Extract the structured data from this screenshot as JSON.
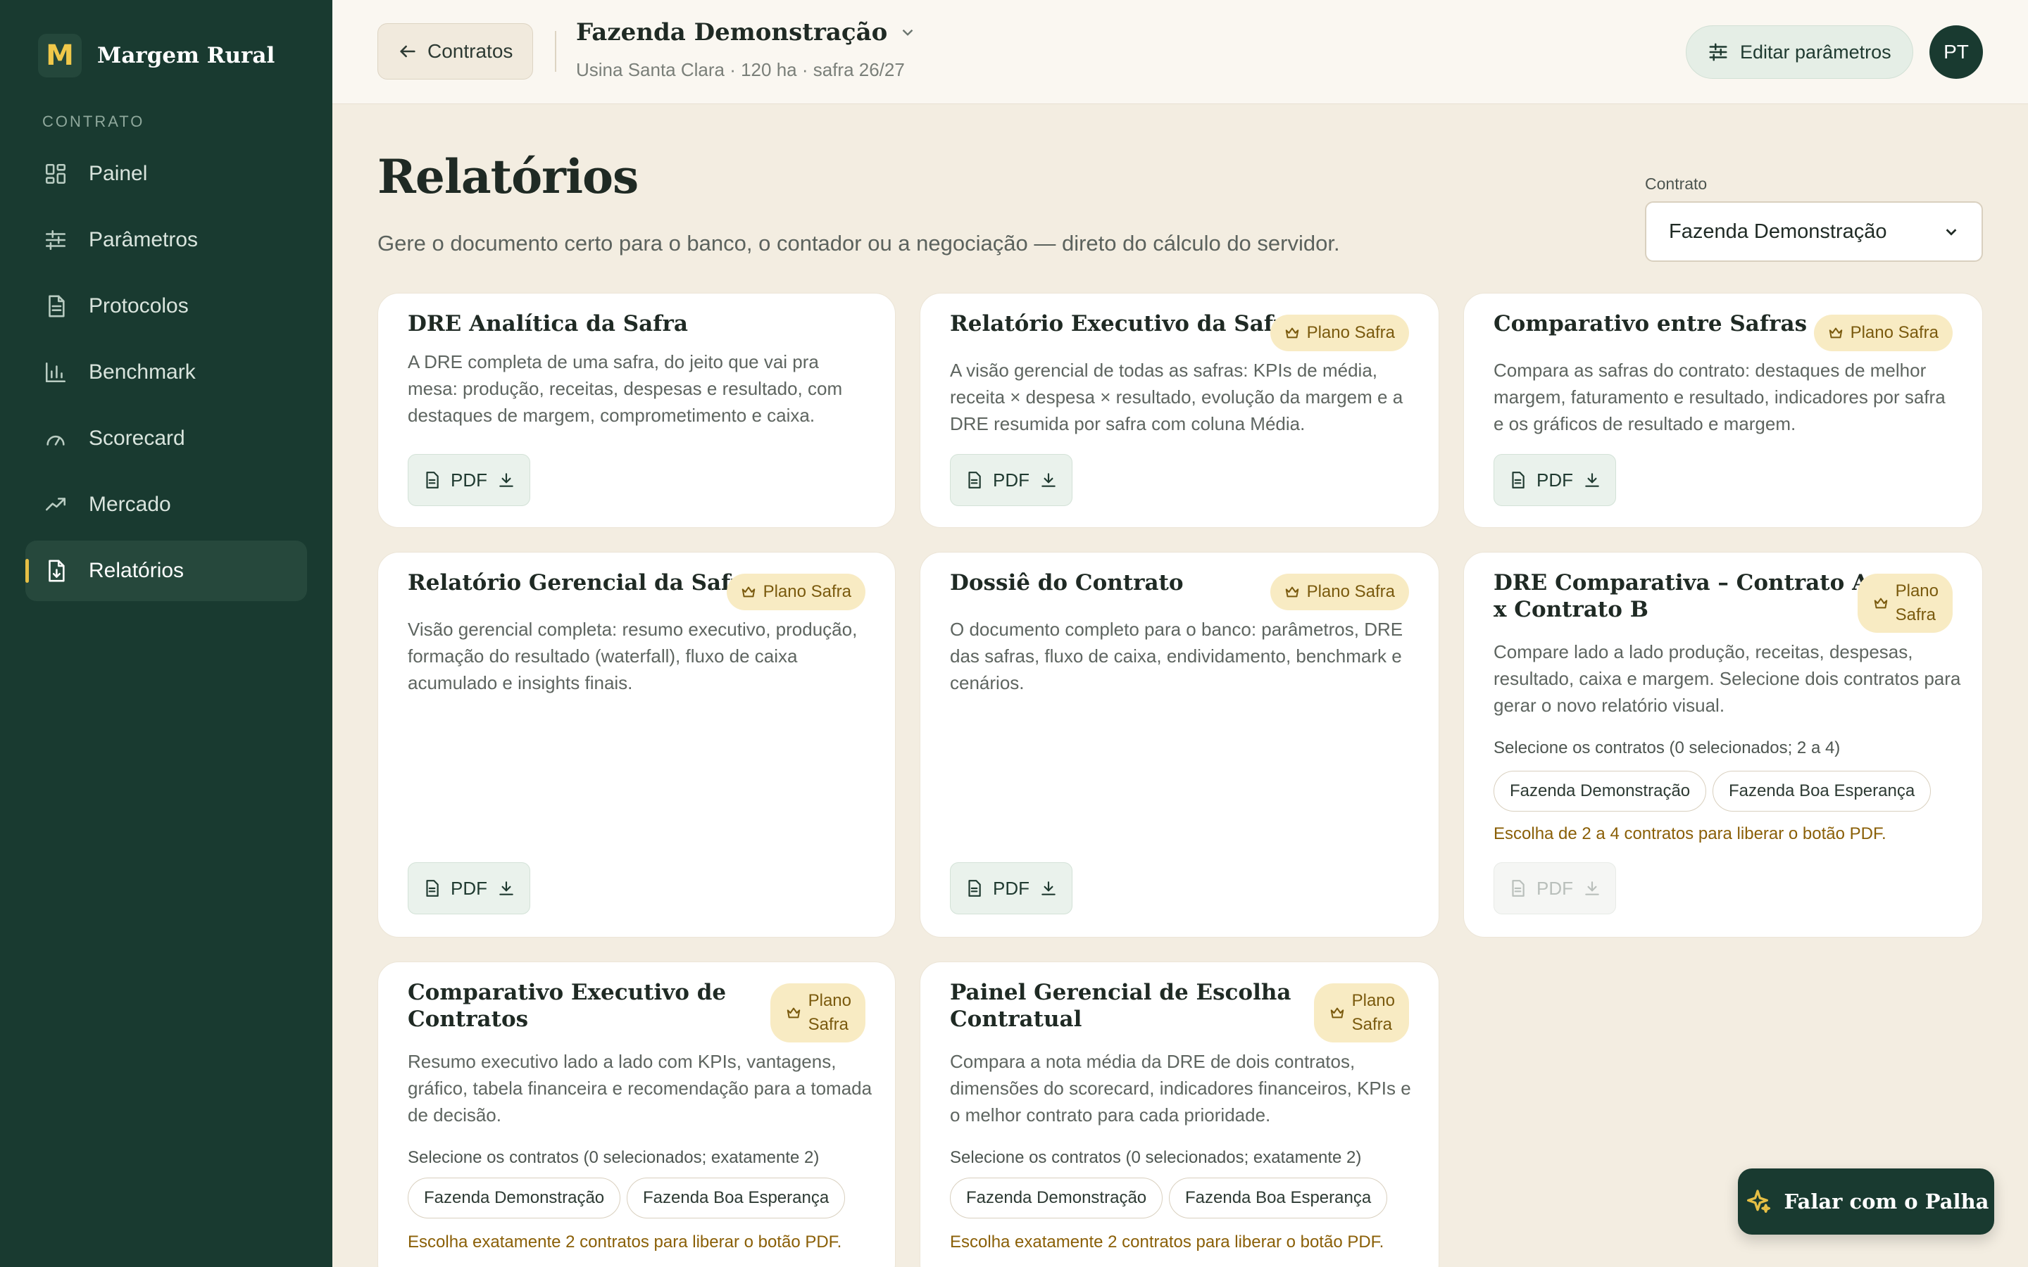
{
  "brand": {
    "logo_letter": "M",
    "name": "Margem Rural"
  },
  "sidebar": {
    "section": "CONTRATO",
    "items": [
      {
        "label": "Painel",
        "icon": "grid-icon"
      },
      {
        "label": "Parâmetros",
        "icon": "sliders-icon"
      },
      {
        "label": "Protocolos",
        "icon": "document-icon"
      },
      {
        "label": "Benchmark",
        "icon": "bar-chart-icon"
      },
      {
        "label": "Scorecard",
        "icon": "gauge-icon"
      },
      {
        "label": "Mercado",
        "icon": "trend-icon"
      },
      {
        "label": "Relatórios",
        "icon": "report-icon",
        "active": true
      }
    ]
  },
  "topbar": {
    "back_label": "Contratos",
    "farm_title": "Fazenda Demonstração",
    "farm_subtitle": "Usina Santa Clara · 120 ha · safra 26/27",
    "edit_label": "Editar parâmetros",
    "avatar_initials": "PT"
  },
  "main": {
    "title": "Relatórios",
    "subtitle": "Gere o documento certo para o banco, o contador ou a negociação — direto do cálculo do servidor.",
    "contract_label": "Contrato",
    "contract_selected": "Fazenda Demonstração"
  },
  "pdf_label": "PDF",
  "badge_label": "Plano Safra",
  "badge_label_lines": [
    "Plano",
    "Safra"
  ],
  "cards": [
    {
      "title": "DRE Analítica da Safra",
      "desc": "A DRE completa de uma safra, do jeito que vai pra mesa: produção, receitas, despesas e resultado, com destaques de margem, comprometimento e caixa."
    },
    {
      "title": "Relatório Executivo da Safra",
      "desc": "A visão gerencial de todas as safras: KPIs de média, receita × despesa × resultado, evolução da margem e a DRE resumida por safra com coluna Média."
    },
    {
      "title": "Comparativo entre Safras",
      "desc": "Compara as safras do contrato: destaques de melhor margem, faturamento e resultado, indicadores por safra e os gráficos de resultado e margem."
    },
    {
      "title": "Relatório Gerencial da Safra",
      "desc": "Visão gerencial completa: resumo executivo, produção, formação do resultado (waterfall), fluxo de caixa acumulado e insights finais."
    },
    {
      "title": "Dossiê do Contrato",
      "desc": "O documento completo para o banco: parâmetros, DRE das safras, fluxo de caixa, endividamento, benchmark e cenários."
    },
    {
      "title_lines": [
        "DRE Comparativa – Contrato A",
        "x Contrato B"
      ],
      "desc": "Compare lado a lado produção, receitas, despesas, resultado, caixa e margem. Selecione dois contratos para gerar o novo relatório visual.",
      "select_label": "Selecione os contratos (0 selecionados; 2 a 4)",
      "chips": [
        "Fazenda Demonstração",
        "Fazenda Boa Esperança"
      ],
      "hint": "Escolha de 2 a 4 contratos para liberar o botão PDF."
    },
    {
      "title_lines": [
        "Comparativo Executivo de",
        "Contratos"
      ],
      "desc": "Resumo executivo lado a lado com KPIs, vantagens, gráfico, tabela financeira e recomendação para a tomada de decisão.",
      "select_label": "Selecione os contratos (0 selecionados; exatamente 2)",
      "chips": [
        "Fazenda Demonstração",
        "Fazenda Boa Esperança"
      ],
      "hint": "Escolha exatamente 2 contratos para liberar o botão PDF."
    },
    {
      "title_lines": [
        "Painel Gerencial de Escolha",
        "Contratual"
      ],
      "desc": "Compara a nota média da DRE de dois contratos, dimensões do scorecard, indicadores financeiros, KPIs e o melhor contrato para cada prioridade.",
      "select_label": "Selecione os contratos (0 selecionados; exatamente 2)",
      "chips": [
        "Fazenda Demonstração",
        "Fazenda Boa Esperança"
      ],
      "hint": "Escolha exatamente 2 contratos para liberar o botão PDF."
    }
  ],
  "chat": {
    "label": "Falar com o Palha"
  }
}
